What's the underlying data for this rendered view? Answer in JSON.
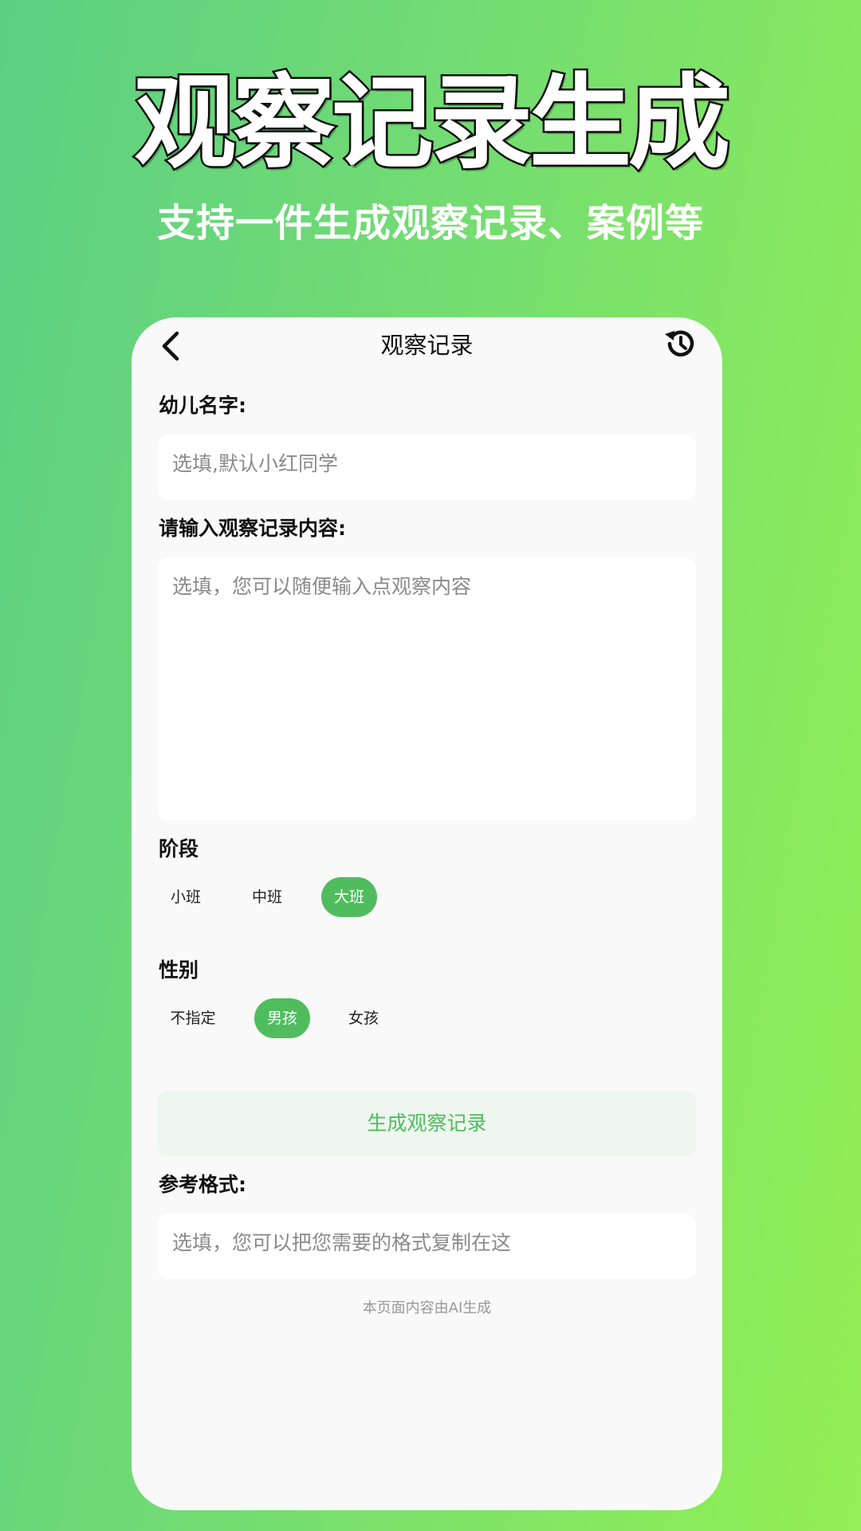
{
  "promo": {
    "title": "观察记录生成",
    "subtitle": "支持一件生成观察记录、案例等"
  },
  "nav": {
    "title": "观察记录",
    "back_icon": "chevron-left-icon",
    "history_icon": "history-icon"
  },
  "form": {
    "child_name": {
      "label": "幼儿名字:",
      "placeholder": "选填,默认小红同学"
    },
    "observation": {
      "label": "请输入观察记录内容:",
      "placeholder": "选填，您可以随便输入点观察内容"
    },
    "stage": {
      "label": "阶段",
      "options": [
        "小班",
        "中班",
        "大班"
      ],
      "selected": "大班"
    },
    "gender": {
      "label": "性别",
      "options": [
        "不指定",
        "男孩",
        "女孩"
      ],
      "selected": "男孩"
    },
    "generate_label": "生成观察记录",
    "format": {
      "label": "参考格式:",
      "placeholder": "选填，您可以把您需要的格式复制在这"
    }
  },
  "footer_note": "本页面内容由AI生成",
  "colors": {
    "accent": "#4fbd5d",
    "button_bg": "#eef6ef",
    "card_bg": "#f9f9f9"
  }
}
